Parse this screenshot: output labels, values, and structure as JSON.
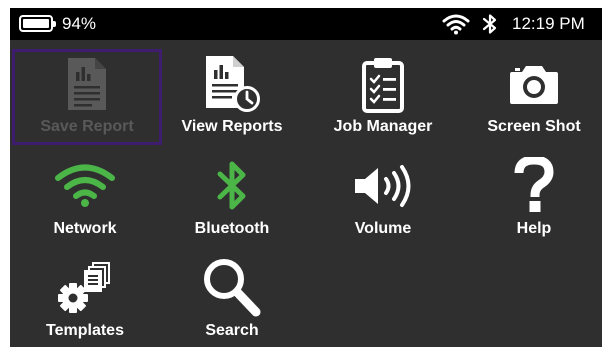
{
  "status_bar": {
    "battery_percent": "94%",
    "battery_level": 0.94,
    "time": "12:19 PM",
    "icons": [
      "battery-icon",
      "wifi-icon",
      "bluetooth-icon"
    ]
  },
  "colors": {
    "background": "#2f2f2f",
    "status_bar": "#000000",
    "label": "#ffffff",
    "disabled": "#595959",
    "network_green": "#4cb548",
    "bluetooth_green": "#4cb548",
    "selection_border": "#3f1d6e"
  },
  "tiles": [
    {
      "label": "Save Report",
      "icon": "save-report-icon",
      "disabled": true,
      "selected": true
    },
    {
      "label": "View Reports",
      "icon": "view-reports-icon"
    },
    {
      "label": "Job Manager",
      "icon": "job-manager-icon"
    },
    {
      "label": "Screen Shot",
      "icon": "camera-icon"
    },
    {
      "label": "Network",
      "icon": "wifi-icon"
    },
    {
      "label": "Bluetooth",
      "icon": "bluetooth-icon"
    },
    {
      "label": "Volume",
      "icon": "volume-icon"
    },
    {
      "label": "Help",
      "icon": "help-icon"
    },
    {
      "label": "Templates",
      "icon": "templates-icon"
    },
    {
      "label": "Search",
      "icon": "search-icon"
    }
  ]
}
